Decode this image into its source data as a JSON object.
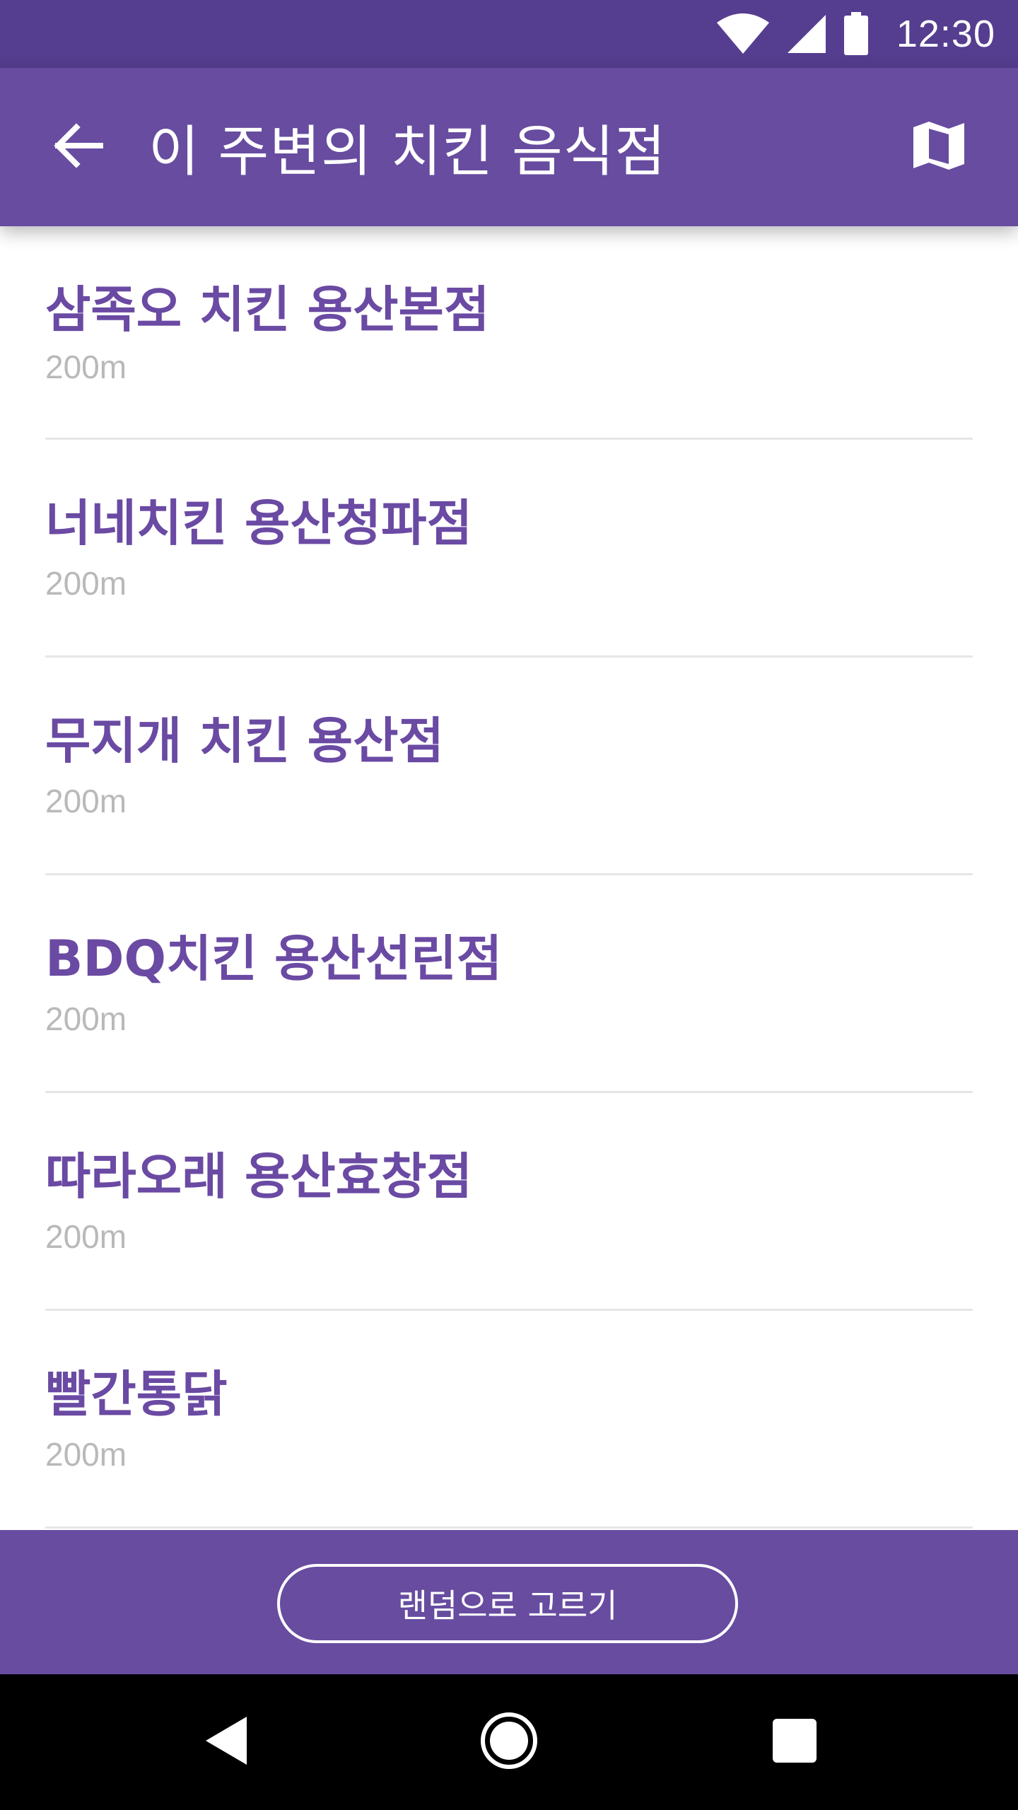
{
  "status_bar": {
    "time": "12:30",
    "icons": [
      "wifi-icon",
      "signal-icon",
      "battery-icon"
    ]
  },
  "app_bar": {
    "title": "이 주변의 치킨 음식점",
    "back_icon": "arrow-back-icon",
    "map_icon": "map-icon"
  },
  "restaurants": [
    {
      "name": "삼족오 치킨 용산본점",
      "distance": "200m"
    },
    {
      "name": "너네치킨 용산청파점",
      "distance": "200m"
    },
    {
      "name": "무지개 치킨 용산점",
      "distance": "200m"
    },
    {
      "name": "BDQ치킨 용산선린점",
      "distance": "200m"
    },
    {
      "name": "따라오래 용산효창점",
      "distance": "200m"
    },
    {
      "name": "빨간통닭",
      "distance": "200m"
    }
  ],
  "action": {
    "random_label": "랜덤으로 고르기"
  },
  "nav_bar": {
    "icons": [
      "nav-back-icon",
      "nav-home-icon",
      "nav-recents-icon"
    ]
  },
  "colors": {
    "status_bar": "#553d8f",
    "primary": "#674ca0",
    "item_name": "#6a4aa3",
    "distance": "#b9b9b9",
    "divider": "#e6e6e6"
  }
}
